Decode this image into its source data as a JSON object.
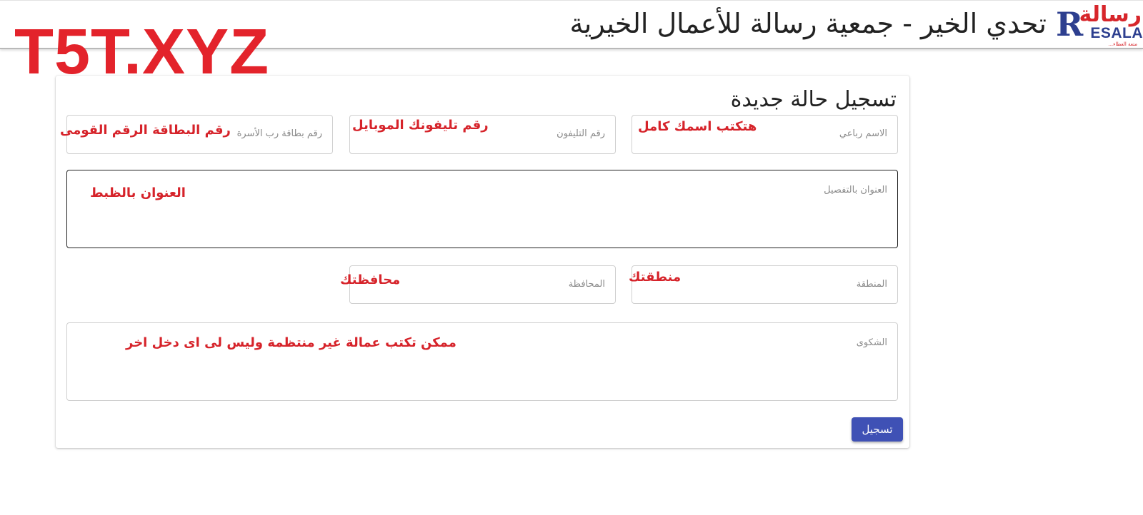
{
  "header": {
    "title": "تحدي الخير - جمعية رسالة للأعمال الخيرية",
    "logo": {
      "arabic": "رسالة",
      "english": "ESALA",
      "letter": "R",
      "tagline": "متعة العطاء..."
    }
  },
  "watermark": "T5T.XYZ",
  "form": {
    "title": "تسجيل حالة جديدة",
    "fields": {
      "full_name": {
        "placeholder": "الاسم رباعي",
        "value": ""
      },
      "phone": {
        "placeholder": "رقم التليفون",
        "value": ""
      },
      "national_id": {
        "placeholder": "رقم بطاقة رب الأسرة",
        "value": ""
      },
      "address": {
        "placeholder": "العنوان بالتفصيل",
        "value": ""
      },
      "area": {
        "placeholder": "المنطقة",
        "value": ""
      },
      "governorate": {
        "placeholder": "المحافظة",
        "value": ""
      },
      "complaint": {
        "placeholder": "الشكوى",
        "value": ""
      }
    },
    "submit_label": "تسجيل"
  },
  "annotations": {
    "full_name": "هتكتب اسمك كامل",
    "phone": "رقم تليفونك الموبايل",
    "national_id": "رقم البطاقة الرقم القومى",
    "address": "العنوان بالظبط",
    "area": "منطقتك",
    "governorate": "محافظتك",
    "complaint": "ممكن تكتب عمالة غير منتظمة وليس لى اى دخل اخر"
  },
  "colors": {
    "accent": "#3f51b5",
    "annotation": "#d6232a",
    "logo_red": "#d7262b",
    "logo_blue": "#2d3f8f"
  }
}
